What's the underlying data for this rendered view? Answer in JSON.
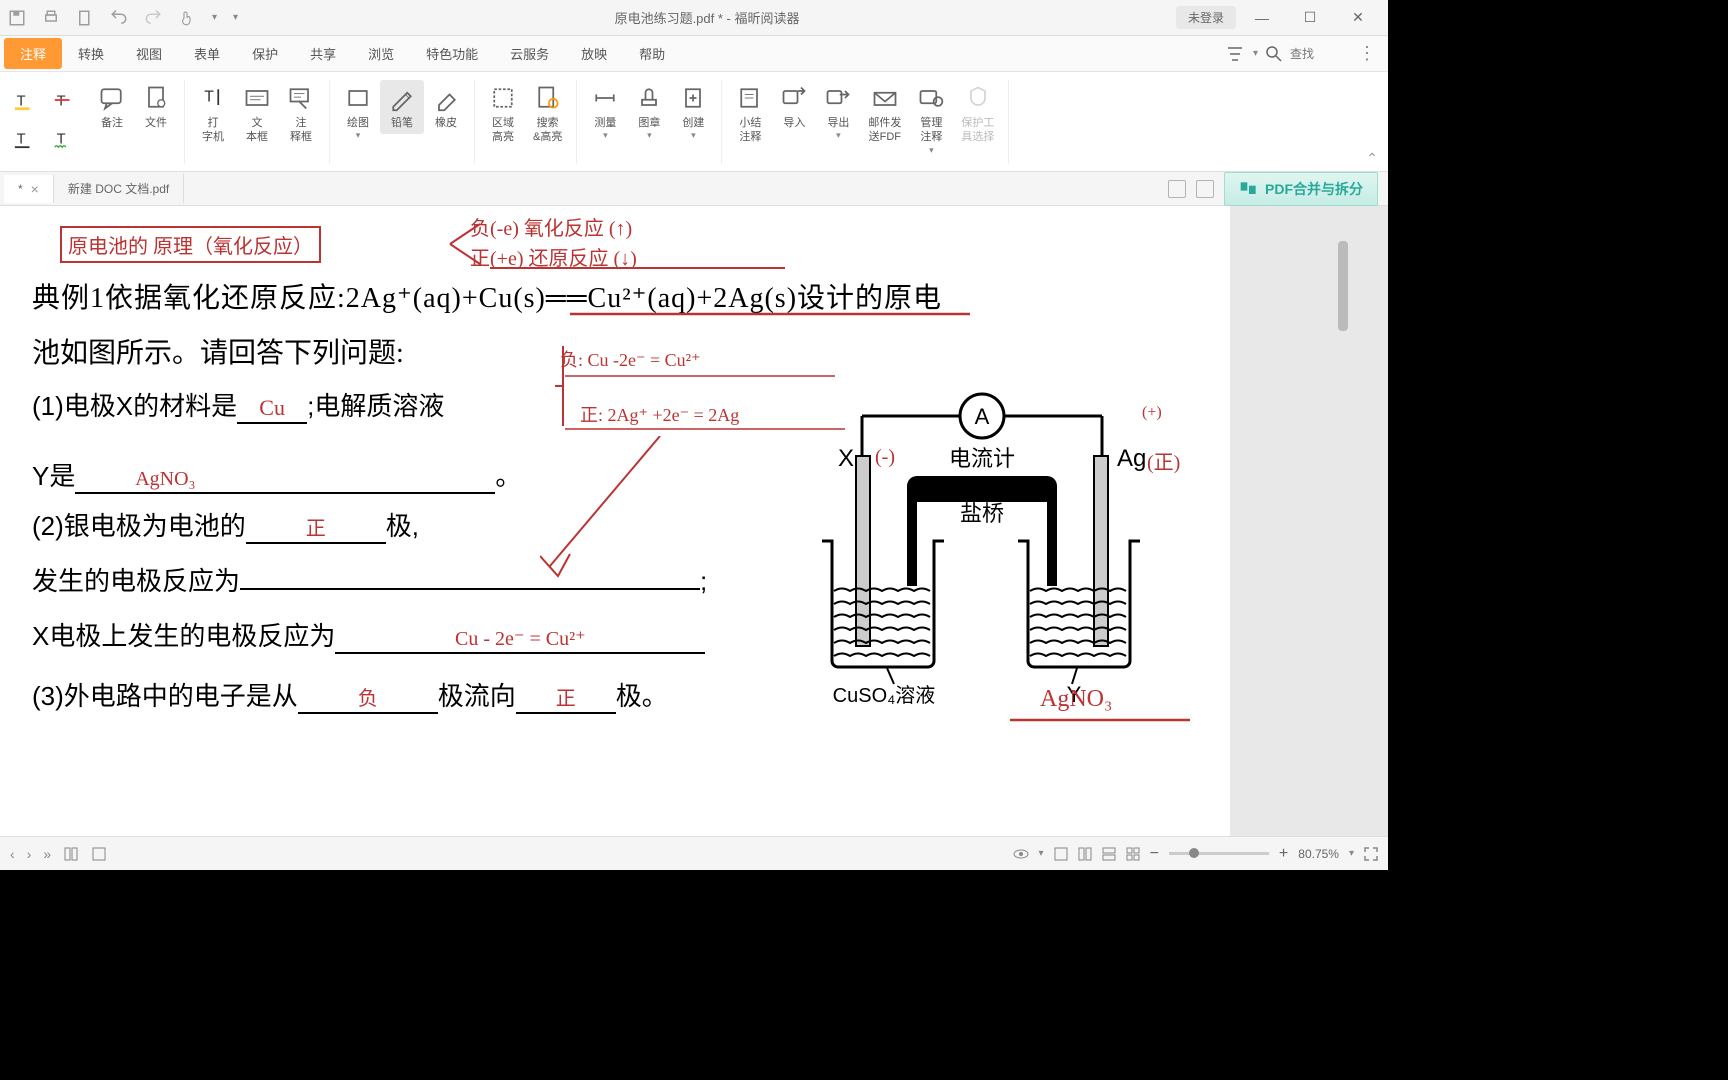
{
  "titlebar": {
    "title": "原电池练习题.pdf * - 福昕阅读器",
    "login": "未登录"
  },
  "menubar": {
    "items": [
      "注释",
      "转换",
      "视图",
      "表单",
      "保护",
      "共享",
      "浏览",
      "特色功能",
      "云服务",
      "放映",
      "帮助"
    ],
    "search_placeholder": "查找"
  },
  "toolbar": {
    "annotate": "备注",
    "file": "文件",
    "typewriter": "打\n字机",
    "textbox": "文\n本框",
    "notebox": "注\n释框",
    "draw": "绘图",
    "pencil": "铅笔",
    "eraser": "橡皮",
    "area_highlight": "区域\n高亮",
    "search_highlight": "搜索\n&高亮",
    "measure": "测量",
    "stamp": "图章",
    "create": "创建",
    "summary": "小结\n注释",
    "import": "导入",
    "export": "导出",
    "email": "邮件发\n送FDF",
    "manage": "管理\n注释",
    "protect": "保护工\n具选择"
  },
  "tabs": {
    "tab1": "*",
    "tab2": "新建 DOC 文档.pdf",
    "pdf_merge": "PDF合并与拆分"
  },
  "document": {
    "line1a": "典例1依据氧化还原反应:2Ag⁺(aq)+Cu(s)══Cu²⁺(aq)+2Ag(s)设计的原电",
    "line1b": "池如图所示。请回答下列问题:",
    "line2a": "(1)电极X的材料是",
    "line2b": ";电解质溶液",
    "line3a": "Y是",
    "line3b": "。",
    "line4a": "(2)银电极为电池的",
    "line4b": "极,",
    "line5a": "发生的电极反应为",
    "line5b": ";",
    "line6a": "X电极上发生的电极反应为",
    "line7a": "(3)外电路中的电子是从",
    "line7b": "极流向",
    "line7c": "极。",
    "diagram_label_A": "A",
    "diagram_label_meter": "电流计",
    "diagram_label_bridge": "盐桥",
    "diagram_label_X": "X",
    "diagram_label_Ag": "Ag",
    "diagram_label_CuSO4": "CuSO₄溶液",
    "diagram_label_Y": "Y"
  },
  "annotations": {
    "title": "原电池的 原理（氧化反应）",
    "top1": "负(-e) 氧化反应 (↑)",
    "top2": "正(+e) 还原反应 (↓)",
    "ans_cu": "Cu",
    "ans_agno3": "AgNO₃",
    "ans_zheng": "正",
    "ans_eq1": "负: Cu  -2e⁻ = Cu²⁺",
    "ans_eq2": "正: 2Ag⁺ +2e⁻ = 2Ag",
    "ans_eq3": "Cu - 2e⁻ = Cu²⁺",
    "ans_fu": "负",
    "ans_zheng2": "正",
    "ans_agno3_2": "AgNO₃",
    "minus": "(-)",
    "plus": "(正)",
    "plus2": "(+)"
  },
  "statusbar": {
    "zoom": "80.75%"
  }
}
